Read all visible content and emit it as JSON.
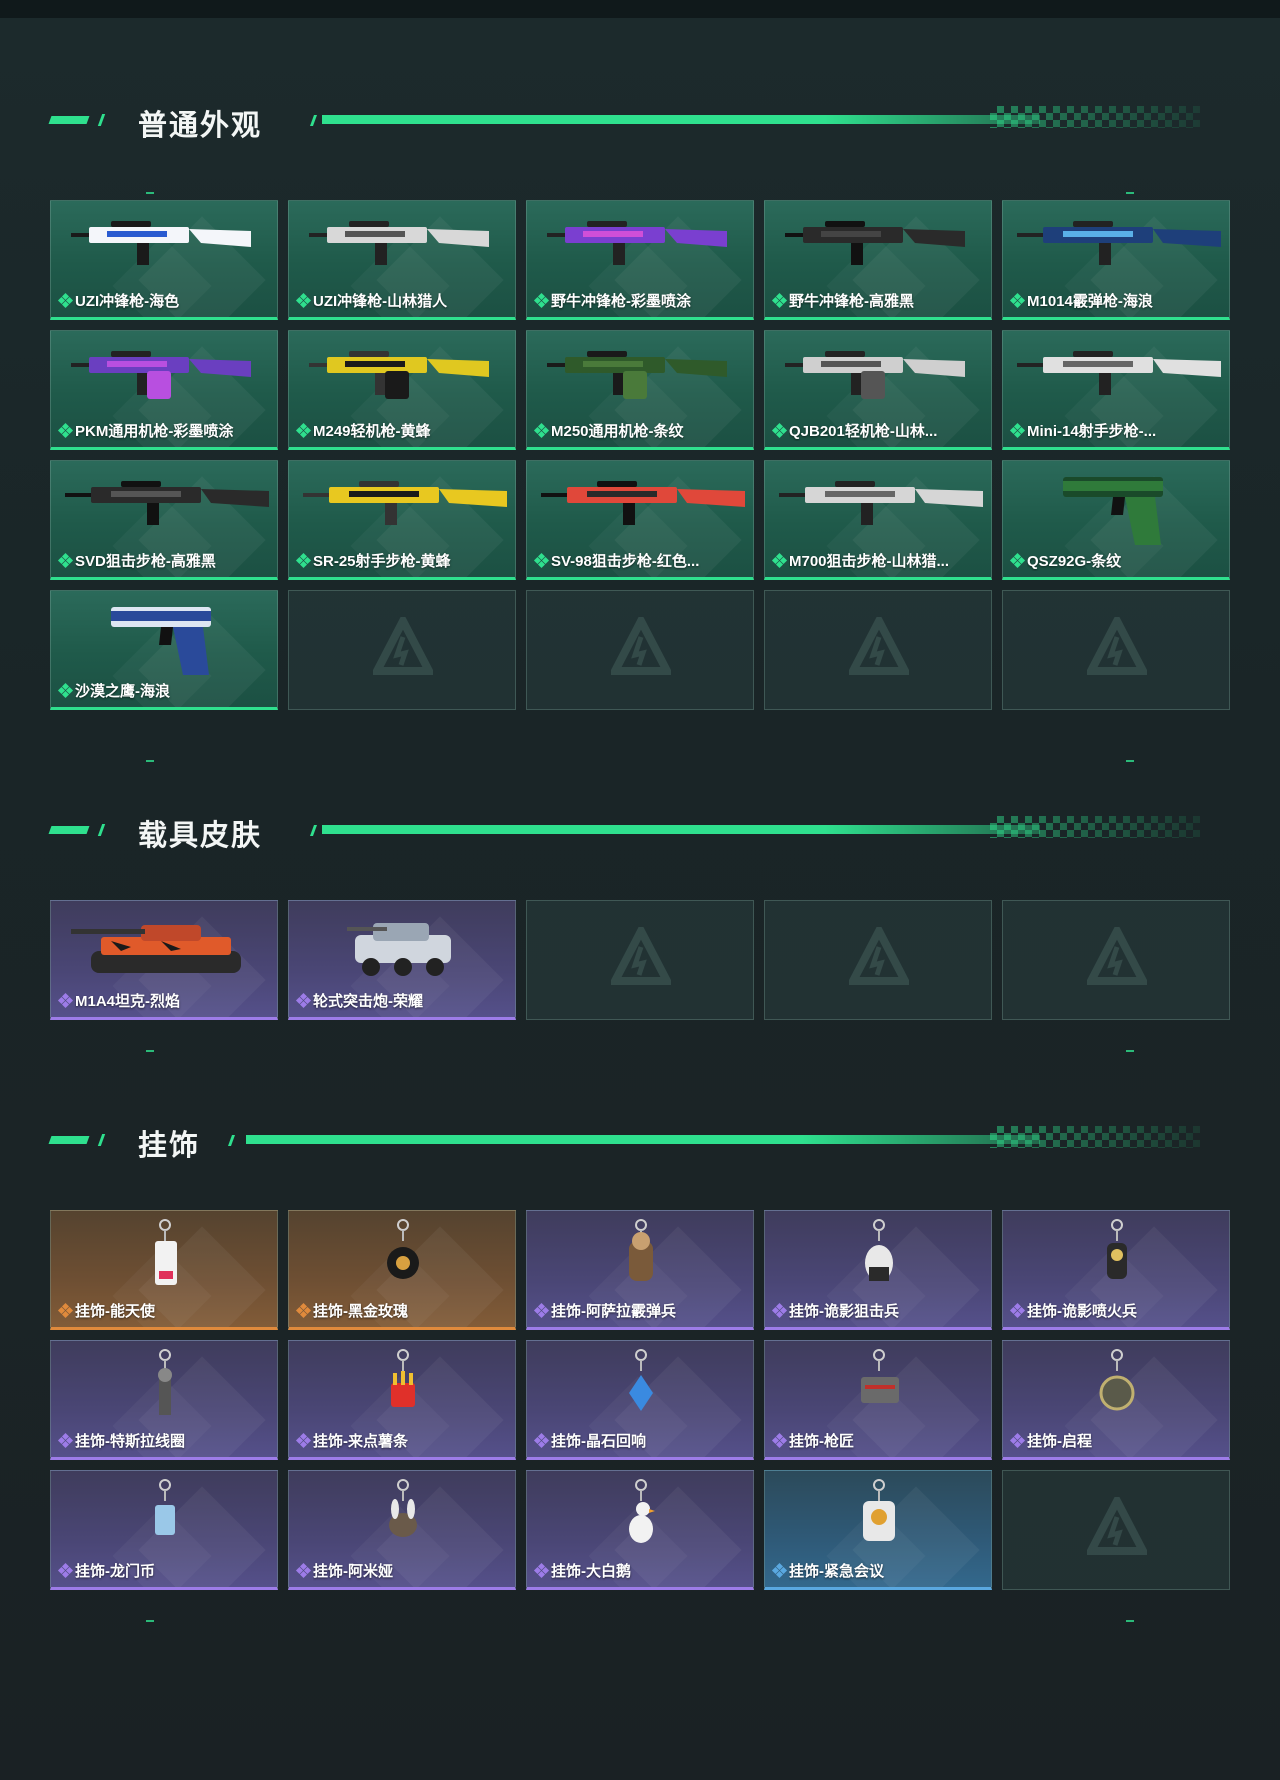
{
  "sections": [
    {
      "title": "普通外观",
      "items": [
        {
          "name": "UZI冲锋枪-海色",
          "rarity": "green",
          "art": "smg-white-blue"
        },
        {
          "name": "UZI冲锋枪-山林猎人",
          "rarity": "green",
          "art": "smg-white-camo"
        },
        {
          "name": "野牛冲锋枪-彩墨喷涂",
          "rarity": "green",
          "art": "smg-purple"
        },
        {
          "name": "野牛冲锋枪-高雅黑",
          "rarity": "green",
          "art": "smg-black"
        },
        {
          "name": "M1014霰弹枪-海浪",
          "rarity": "green",
          "art": "shotgun-blue"
        },
        {
          "name": "PKM通用机枪-彩墨喷涂",
          "rarity": "green",
          "art": "mg-purple"
        },
        {
          "name": "M249轻机枪-黄蜂",
          "rarity": "green",
          "art": "mg-yellow"
        },
        {
          "name": "M250通用机枪-条纹",
          "rarity": "green",
          "art": "mg-green"
        },
        {
          "name": "QJB201轻机枪-山林...",
          "rarity": "green",
          "art": "mg-white"
        },
        {
          "name": "Mini-14射手步枪-...",
          "rarity": "green",
          "art": "rifle-white"
        },
        {
          "name": "SVD狙击步枪-高雅黑",
          "rarity": "green",
          "art": "sniper-black"
        },
        {
          "name": "SR-25射手步枪-黄蜂",
          "rarity": "green",
          "art": "rifle-yellow"
        },
        {
          "name": "SV-98狙击步枪-红色...",
          "rarity": "green",
          "art": "sniper-red"
        },
        {
          "name": "M700狙击步枪-山林猎...",
          "rarity": "green",
          "art": "sniper-white"
        },
        {
          "name": "QSZ92G-条纹",
          "rarity": "green",
          "art": "pistol-green"
        },
        {
          "name": "沙漠之鹰-海浪",
          "rarity": "green",
          "art": "pistol-blue"
        },
        {
          "empty": true
        },
        {
          "empty": true
        },
        {
          "empty": true
        },
        {
          "empty": true
        }
      ]
    },
    {
      "title": "载具皮肤",
      "items": [
        {
          "name": "M1A4坦克-烈焰",
          "rarity": "purple",
          "art": "tank"
        },
        {
          "name": "轮式突击炮-荣耀",
          "rarity": "purple",
          "art": "vehicle"
        },
        {
          "empty": true
        },
        {
          "empty": true
        },
        {
          "empty": true
        }
      ]
    },
    {
      "title": "挂饰",
      "items": [
        {
          "name": "挂饰-能天使",
          "rarity": "orange",
          "art": "charm-card"
        },
        {
          "name": "挂饰-黑金玫瑰",
          "rarity": "orange",
          "art": "charm-rose"
        },
        {
          "name": "挂饰-阿萨拉霰弹兵",
          "rarity": "purple",
          "art": "charm-soldier"
        },
        {
          "name": "挂饰-诡影狙击兵",
          "rarity": "purple",
          "art": "charm-duck"
        },
        {
          "name": "挂饰-诡影喷火兵",
          "rarity": "purple",
          "art": "charm-figure"
        },
        {
          "name": "挂饰-特斯拉线圈",
          "rarity": "purple",
          "art": "charm-coil"
        },
        {
          "name": "挂饰-来点薯条",
          "rarity": "purple",
          "art": "charm-fries"
        },
        {
          "name": "挂饰-晶石回响",
          "rarity": "purple",
          "art": "charm-crystal"
        },
        {
          "name": "挂饰-枪匠",
          "rarity": "purple",
          "art": "charm-tag"
        },
        {
          "name": "挂饰-启程",
          "rarity": "purple",
          "art": "charm-medal"
        },
        {
          "name": "挂饰-龙门币",
          "rarity": "purple",
          "art": "charm-coin"
        },
        {
          "name": "挂饰-阿米娅",
          "rarity": "purple",
          "art": "charm-bunny"
        },
        {
          "name": "挂饰-大白鹅",
          "rarity": "purple",
          "art": "charm-goose"
        },
        {
          "name": "挂饰-紧急会议",
          "rarity": "blue",
          "art": "charm-badge"
        },
        {
          "empty": true
        }
      ]
    }
  ],
  "colors": {
    "accent": "#2fe08e",
    "green": "#2fe08e",
    "purple": "#9d7ce8",
    "orange": "#e08a3c",
    "blue": "#5aa8e0"
  }
}
